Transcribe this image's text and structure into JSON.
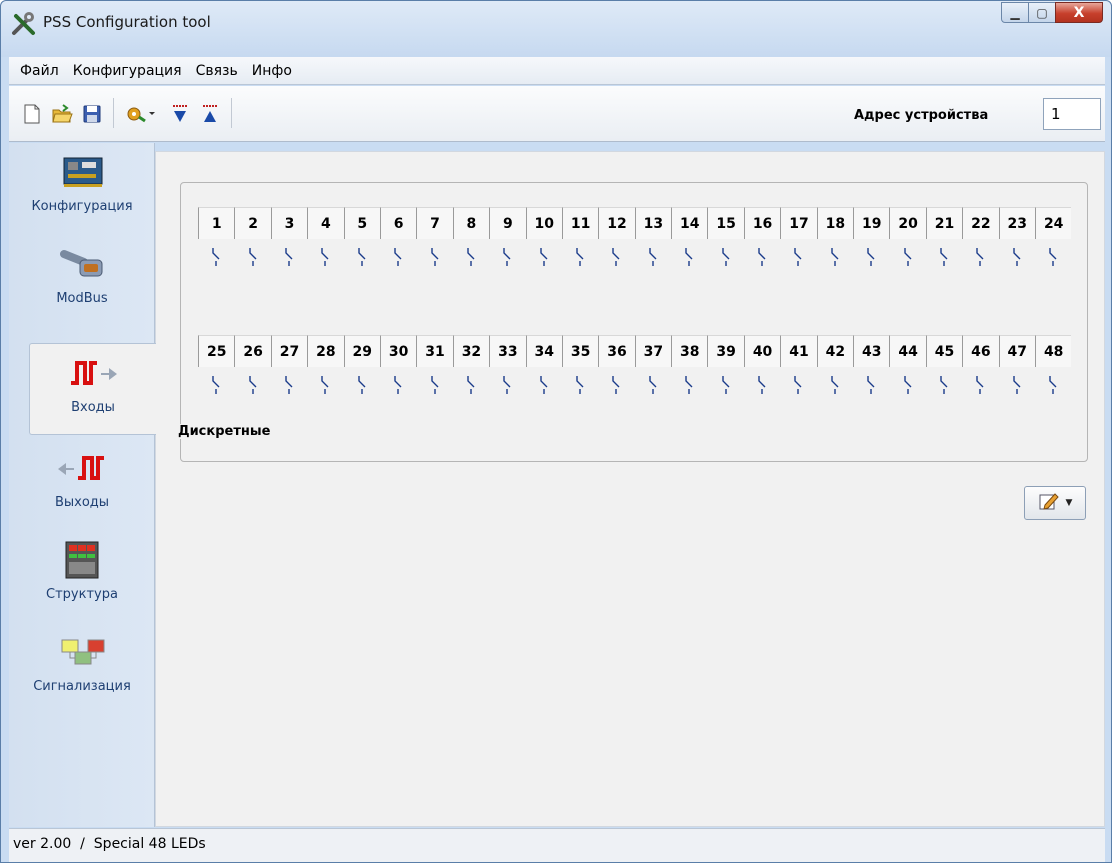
{
  "window": {
    "title": "PSS Configuration tool",
    "min_label": "▁",
    "max_label": "▢",
    "close_label": "X"
  },
  "menu": {
    "items": [
      "Файл",
      "Конфигурация",
      "Связь",
      "Инфо"
    ]
  },
  "toolbar": {
    "icons": [
      "new-file-icon",
      "open-folder-icon",
      "save-icon",
      "connect-gear-icon",
      "download-icon",
      "upload-icon"
    ],
    "address_label": "Адрес устройства",
    "address_value": "1"
  },
  "sidebar": {
    "items": [
      {
        "label": "Конфигурация",
        "icon": "circuit-board-icon"
      },
      {
        "label": "ModBus",
        "icon": "serial-connector-icon"
      },
      {
        "label": "Входы",
        "icon": "input-pulse-icon"
      },
      {
        "label": "Выходы",
        "icon": "output-pulse-icon"
      },
      {
        "label": "Структура",
        "icon": "rack-module-icon"
      },
      {
        "label": "Сигнализация",
        "icon": "alarm-blocks-icon"
      }
    ],
    "active": "Входы"
  },
  "main": {
    "group_title": "Дискретные",
    "row1": [
      "1",
      "2",
      "3",
      "4",
      "5",
      "6",
      "7",
      "8",
      "9",
      "10",
      "11",
      "12",
      "13",
      "14",
      "15",
      "16",
      "17",
      "18",
      "19",
      "20",
      "21",
      "22",
      "23",
      "24"
    ],
    "row2": [
      "25",
      "26",
      "27",
      "28",
      "29",
      "30",
      "31",
      "32",
      "33",
      "34",
      "35",
      "36",
      "37",
      "38",
      "39",
      "40",
      "41",
      "42",
      "43",
      "44",
      "45",
      "46",
      "47",
      "48"
    ]
  },
  "status": {
    "text": "ver 2.00  /  Special 48 LEDs"
  },
  "colors": {
    "accent": "#1e3f72",
    "pulse_red": "#d81010",
    "switch_blue": "#1a3b8a",
    "close_red": "#c7402c"
  }
}
